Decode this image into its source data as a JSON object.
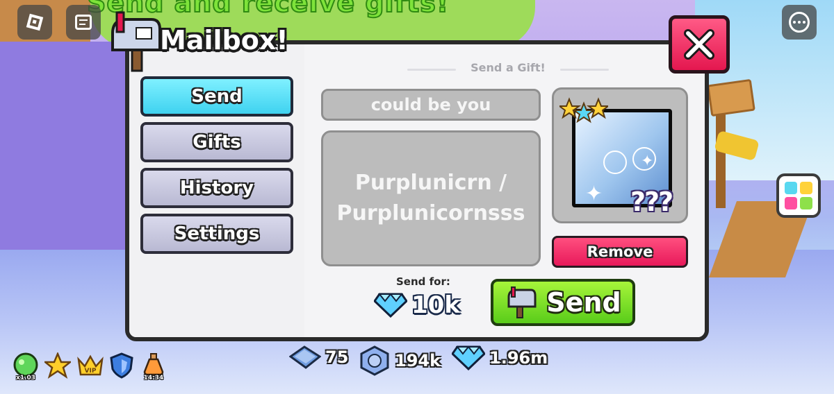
{
  "game": {
    "headline": "Send and receive gifts!",
    "title": "Mailbox!"
  },
  "hud": {
    "roblox_icon": "roblox-menu-icon",
    "chat_icon": "chat-icon",
    "more_icon": "more-options-icon"
  },
  "sidebar": {
    "items": [
      {
        "label": "Send",
        "active": true
      },
      {
        "label": "Gifts",
        "active": false
      },
      {
        "label": "History",
        "active": false
      },
      {
        "label": "Settings",
        "active": false
      }
    ]
  },
  "gift": {
    "section_title": "Send a Gift!",
    "recipient_placeholder": "could be you",
    "message_lines": [
      "Purplunicrn /",
      "Purplunicornsss"
    ],
    "item_hidden_label": "???",
    "remove_label": "Remove",
    "send_for_label": "Send for:",
    "price": "10k",
    "send_label": "Send"
  },
  "currencies": [
    {
      "icon": "ticket-icon",
      "value": "75"
    },
    {
      "icon": "coin-icon",
      "value": "194k"
    },
    {
      "icon": "diamond-icon",
      "value": "1.96m"
    }
  ],
  "boosts": [
    {
      "icon": "green-orb-icon",
      "label": "x1.03"
    },
    {
      "icon": "star-icon",
      "label": ""
    },
    {
      "icon": "vip-crown-icon",
      "label": ""
    },
    {
      "icon": "shield-icon",
      "label": ""
    },
    {
      "icon": "potion-icon",
      "label": "14:34"
    }
  ],
  "colors": {
    "active_tab": "#3fd2f0",
    "send_button": "#59cc1a",
    "remove_button": "#e8195a",
    "close_button": "#e4174f"
  }
}
